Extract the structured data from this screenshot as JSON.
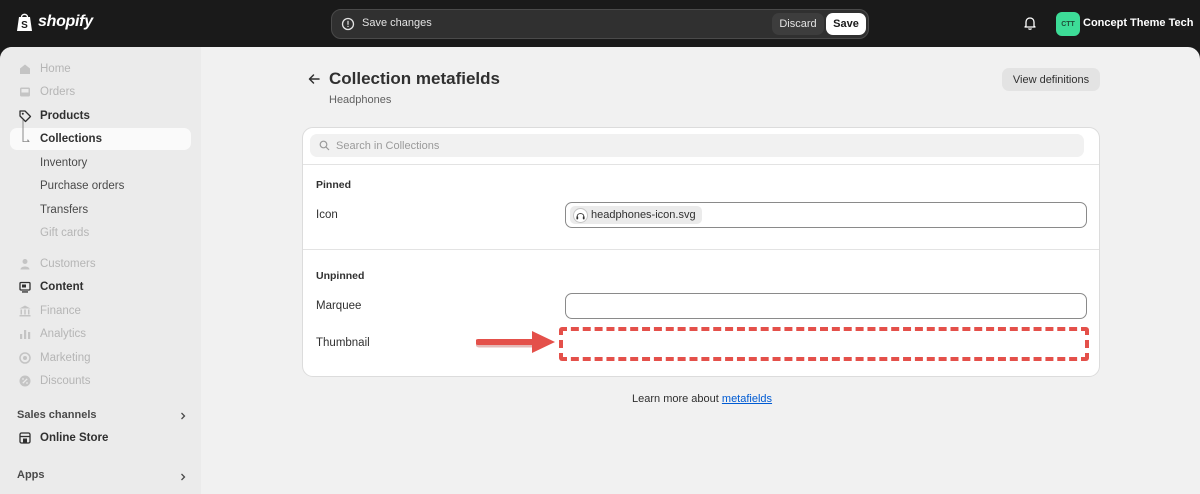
{
  "topbar": {
    "brand": "shopify",
    "save_message": "Save changes",
    "discard_label": "Discard",
    "save_label": "Save",
    "avatar_initials": "CTT",
    "store_name": "Concept Theme Tech"
  },
  "sidebar": {
    "items": [
      {
        "label": "Home",
        "icon": "home-icon"
      },
      {
        "label": "Orders",
        "icon": "inbox-icon"
      },
      {
        "label": "Products",
        "icon": "tag-icon"
      },
      {
        "label": "Collections",
        "icon": "subitem-arrow-icon"
      },
      {
        "label": "Inventory"
      },
      {
        "label": "Purchase orders"
      },
      {
        "label": "Transfers"
      },
      {
        "label": "Gift cards"
      },
      {
        "label": "Customers",
        "icon": "person-icon"
      },
      {
        "label": "Content",
        "icon": "content-icon"
      },
      {
        "label": "Finance",
        "icon": "bank-icon"
      },
      {
        "label": "Analytics",
        "icon": "bar-chart-icon"
      },
      {
        "label": "Marketing",
        "icon": "target-icon"
      },
      {
        "label": "Discounts",
        "icon": "discount-icon"
      }
    ],
    "sales_channels_label": "Sales channels",
    "online_store_label": "Online Store",
    "apps_label": "Apps"
  },
  "main": {
    "title": "Collection metafields",
    "subtitle": "Headphones",
    "view_definitions_label": "View definitions",
    "search_placeholder": "Search in Collections",
    "pinned_title": "Pinned",
    "icon_label": "Icon",
    "icon_file": "headphones-icon.svg",
    "unpinned_title": "Unpinned",
    "marquee_label": "Marquee",
    "thumbnail_label": "Thumbnail",
    "footer_text": "Learn more about",
    "footer_link": "metafields"
  },
  "colors": {
    "topbar_bg": "#1a1a1a",
    "callout_red": "#e4504a",
    "link_blue": "#005bd3",
    "avatar_green": "#3ddc97"
  }
}
